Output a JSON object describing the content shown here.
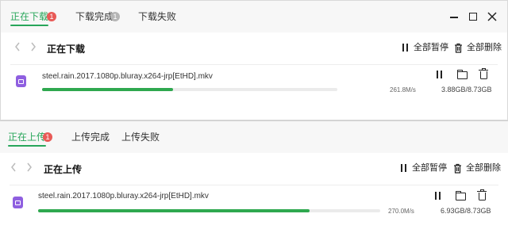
{
  "download_window": {
    "tabs": [
      {
        "label": "正在下载",
        "badge": "1",
        "active": true
      },
      {
        "label": "下载完成",
        "badge": "1",
        "active": false
      },
      {
        "label": "下载失败",
        "active": false
      }
    ],
    "section_title": "正在下载",
    "pause_all_label": "全部暂停",
    "delete_all_label": "全部删除",
    "file": {
      "name": "steel.rain.2017.1080p.bluray.x264-jrp[EtHD].mkv",
      "speed": "261.8M/s",
      "size": "3.88GB/8.73GB",
      "progress": 0.444
    }
  },
  "upload_window": {
    "tabs": [
      {
        "label": "正在上传",
        "badge": "1",
        "active": true
      },
      {
        "label": "上传完成",
        "active": false
      },
      {
        "label": "上传失败",
        "active": false
      }
    ],
    "section_title": "正在上传",
    "pause_all_label": "全部暂停",
    "delete_all_label": "全部删除",
    "file": {
      "name": "steel.rain.2017.1080p.bluray.x264-jrp[EtHD].mkv",
      "speed": "270.0M/s",
      "size": "6.93GB/8.73GB",
      "progress": 0.794
    }
  },
  "colors": {
    "accent": "#27a65a",
    "progress": "#2fa84f",
    "badge_red": "#e85a57",
    "badge_grey": "#b5b5b5",
    "file_icon": "#8f5fe0"
  }
}
